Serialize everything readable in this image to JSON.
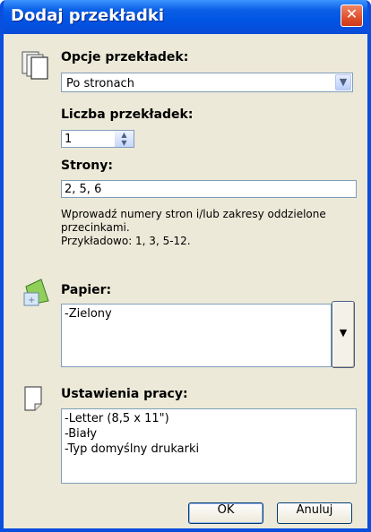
{
  "window": {
    "title": "Dodaj przekładki"
  },
  "options": {
    "label": "Opcje przekładek:",
    "value": "Po stronach"
  },
  "count": {
    "label": "Liczba przekładek:",
    "value": "1"
  },
  "pages": {
    "label": "Strony:",
    "value": "2, 5, 6",
    "help_line1": "Wprowadź numery stron i/lub zakresy oddzielone",
    "help_line2": "przecinkami.",
    "help_line3": "Przykładowo: 1, 3, 5-12."
  },
  "paper": {
    "label": "Papier:",
    "lines": [
      "-Zielony"
    ]
  },
  "job": {
    "label": "Ustawienia pracy:",
    "lines": [
      "-Letter (8,5 x 11\")",
      "-Biały",
      "-Typ domyślny drukarki"
    ]
  },
  "buttons": {
    "ok": "OK",
    "cancel": "Anuluj"
  },
  "icons": {
    "close": "close-icon",
    "options": "pages-stack-icon",
    "paper": "paper-tab-icon",
    "job": "page-icon",
    "dropdown": "chevron-down-icon"
  }
}
